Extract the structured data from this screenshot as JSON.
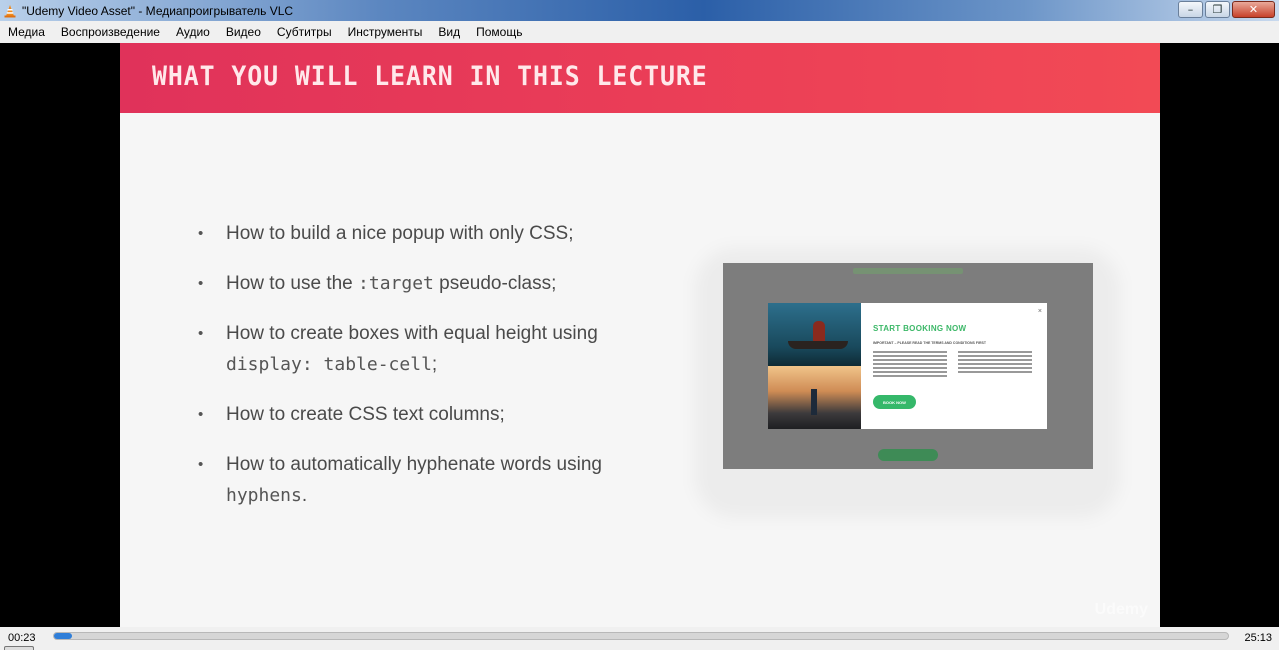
{
  "window": {
    "title": "\"Udemy Video Asset\" - Медиапроигрыватель VLC",
    "icon": "vlc-cone-icon",
    "buttons": {
      "minimize": "–",
      "restore": "❐",
      "close": "✕"
    }
  },
  "menu": {
    "items": [
      "Медиа",
      "Воспроизведение",
      "Аудио",
      "Видео",
      "Субтитры",
      "Инструменты",
      "Вид",
      "Помощь"
    ]
  },
  "slide": {
    "title": "WHAT YOU WILL LEARN IN THIS LECTURE",
    "bullets": [
      {
        "pre": "How to build a nice popup with only CSS;",
        "code": "",
        "post": ""
      },
      {
        "pre": "How to use the ",
        "code": ":target",
        "post": " pseudo-class;"
      },
      {
        "pre": "How to create boxes with equal height using ",
        "code": "display: table-cell",
        "post": ";"
      },
      {
        "pre": "How to create CSS text columns;",
        "code": "",
        "post": ""
      },
      {
        "pre": "How to automatically hyphenate words using ",
        "code": "hyphens",
        "post": "."
      }
    ],
    "bullet_char": "•",
    "popup": {
      "title": "START BOOKING NOW",
      "subtitle": "IMPORTANT – PLEASE READ THE TERMS AND CONDITIONS FIRST",
      "button": "BOOK NOW",
      "close": "×"
    },
    "watermark": "Udemy",
    "colors": {
      "header": "#e8385a",
      "popup_accent": "#35b86a"
    }
  },
  "controls": {
    "elapsed": "00:23",
    "total": "25:13",
    "progress": 0.015,
    "accent": "#2f7ed8"
  }
}
